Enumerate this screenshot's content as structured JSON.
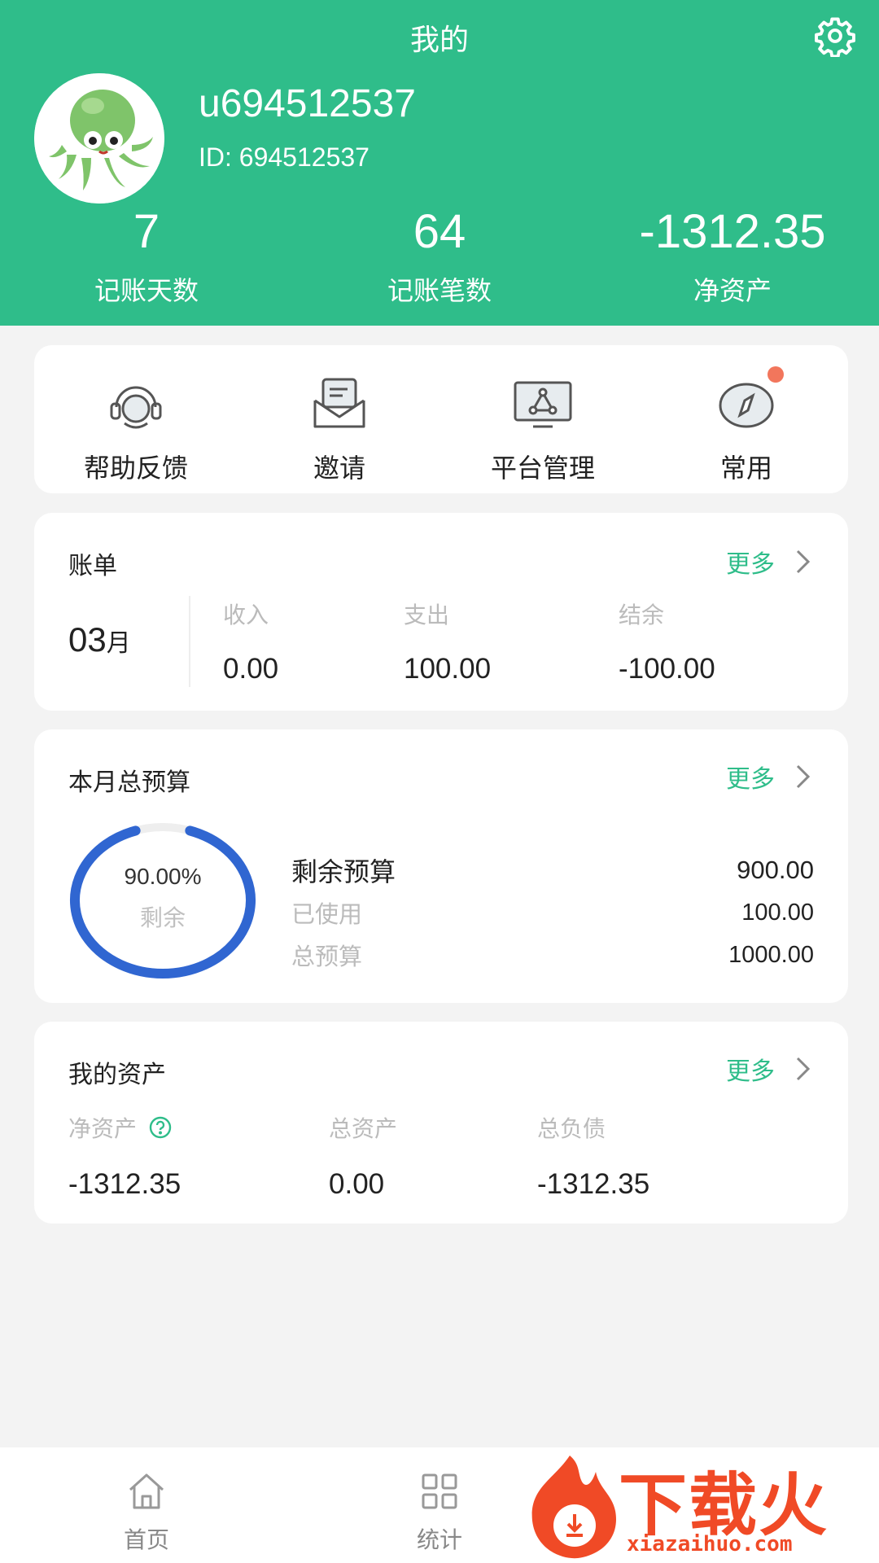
{
  "header": {
    "title": "我的",
    "username": "u694512537",
    "user_id": "ID: 694512537"
  },
  "stats": [
    {
      "value": "7",
      "label": "记账天数"
    },
    {
      "value": "64",
      "label": "记账笔数"
    },
    {
      "value": "-1312.35",
      "label": "净资产"
    }
  ],
  "quick_actions": [
    {
      "label": "帮助反馈",
      "icon": "headset-icon"
    },
    {
      "label": "邀请",
      "icon": "envelope-icon"
    },
    {
      "label": "平台管理",
      "icon": "platform-icon"
    },
    {
      "label": "常用",
      "icon": "compass-icon",
      "badge": true
    }
  ],
  "bill": {
    "title": "账单",
    "more": "更多",
    "month_num": "03",
    "month_unit": "月",
    "columns": [
      {
        "label": "收入",
        "value": "0.00"
      },
      {
        "label": "支出",
        "value": "100.00"
      },
      {
        "label": "结余",
        "value": "-100.00"
      }
    ]
  },
  "budget": {
    "title": "本月总预算",
    "more": "更多",
    "ring_percent": "90.00%",
    "ring_label": "剩余",
    "remaining_fraction": 0.9,
    "rows": [
      {
        "label": "剩余预算",
        "value": "900.00"
      },
      {
        "label": "已使用",
        "value": "100.00"
      },
      {
        "label": "总预算",
        "value": "1000.00"
      }
    ]
  },
  "assets": {
    "title": "我的资产",
    "more": "更多",
    "columns": [
      {
        "label": "净资产",
        "value": "-1312.35"
      },
      {
        "label": "总资产",
        "value": "0.00"
      },
      {
        "label": "总负债",
        "value": "-1312.35"
      }
    ]
  },
  "tabs": [
    {
      "label": "首页",
      "icon": "home-icon"
    },
    {
      "label": "统计",
      "icon": "grid-icon"
    }
  ],
  "watermark": {
    "brand": "下载火",
    "url": "xiazaihuo.com"
  },
  "colors": {
    "primary": "#2fbd8a",
    "ring": "#3066d1",
    "badge": "#f2765c",
    "watermark": "#f04a26"
  }
}
